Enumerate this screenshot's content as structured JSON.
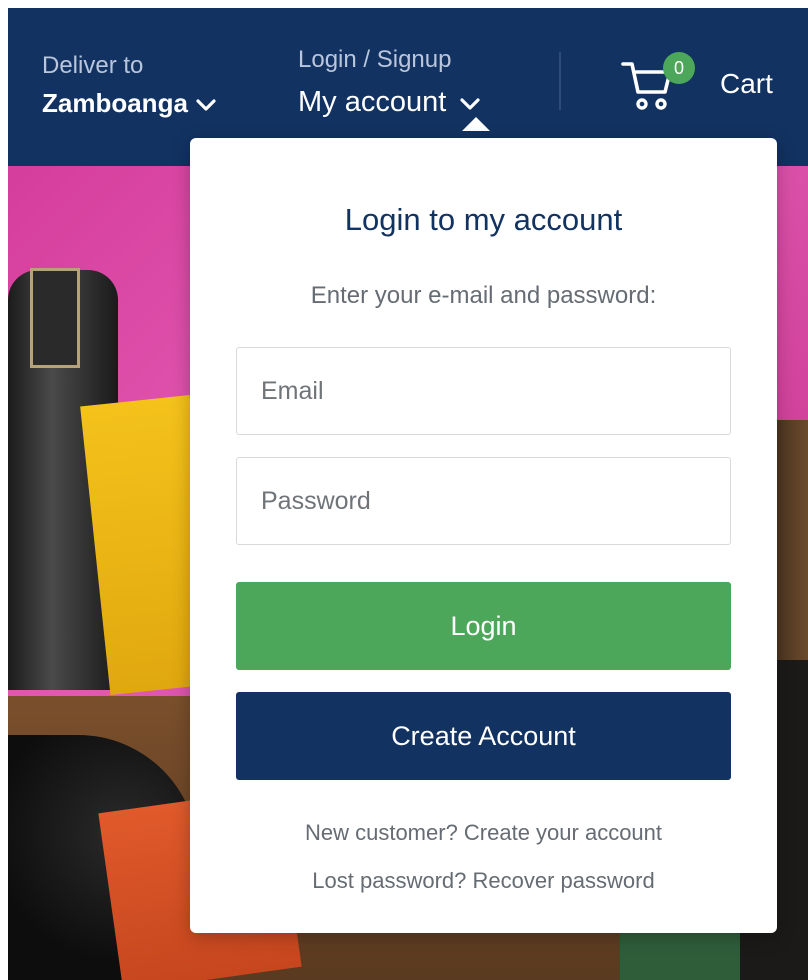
{
  "header": {
    "deliver_label": "Deliver to",
    "deliver_city": "Zamboanga",
    "login_label": "Login / Signup",
    "account_label": "My account",
    "cart_count": "0",
    "cart_label": "Cart",
    "bg_color": "#123261",
    "badge_color": "#4ca75b"
  },
  "login_panel": {
    "title": "Login to my account",
    "subtitle": "Enter your e-mail and password:",
    "email_placeholder": "Email",
    "password_placeholder": "Password",
    "login_button": "Login",
    "create_button": "Create Account",
    "new_customer_link": "New customer? Create your account",
    "lost_password_link": "Lost password? Recover password",
    "login_button_color": "#4ca75b",
    "create_button_color": "#123261"
  },
  "icons": {
    "deliver_chevron": "chevron-down-icon",
    "account_chevron": "chevron-down-icon",
    "cart": "cart-icon"
  }
}
